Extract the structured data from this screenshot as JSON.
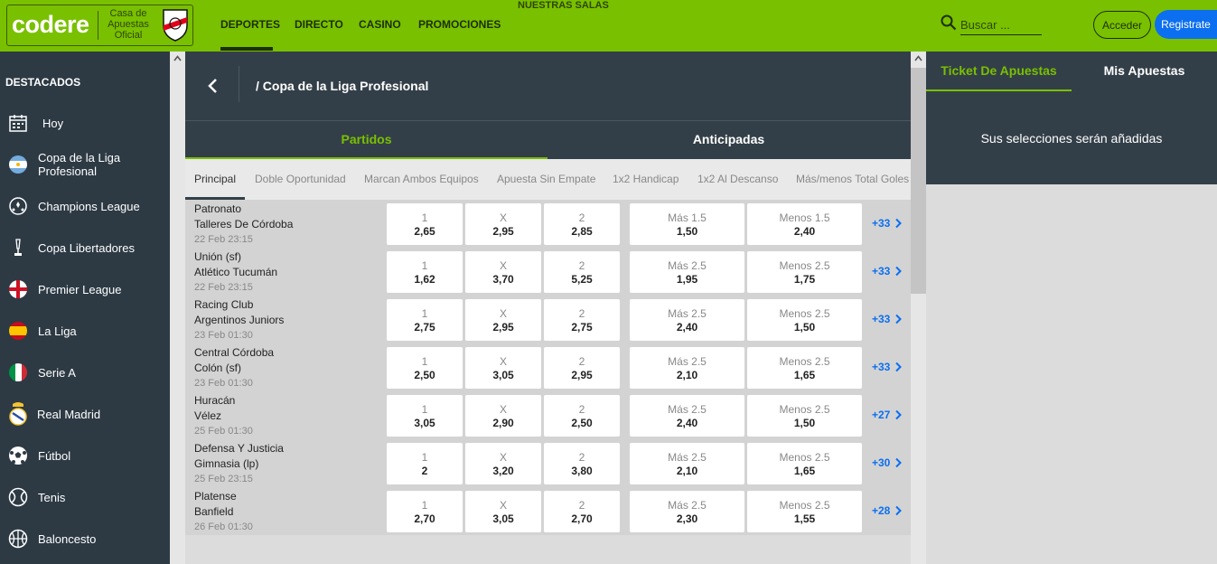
{
  "header": {
    "logo": "codere",
    "logo_tagline": "Casa de Apuestas Oficial",
    "nav": [
      "DEPORTES",
      "DIRECTO",
      "CASINO",
      "PROMOCIONES"
    ],
    "nuestras_salas": "NUESTRAS SALAS",
    "search_placeholder": "Buscar ...",
    "login_label": "Acceder",
    "register_label": "Registrate"
  },
  "sidebar": {
    "title": "DESTACADOS",
    "items": [
      {
        "label": "Hoy",
        "icon": "calendar-icon"
      },
      {
        "label": "Copa de la Liga Profesional",
        "icon": "argentina-flag-icon"
      },
      {
        "label": "Champions League",
        "icon": "football-stars-icon"
      },
      {
        "label": "Copa Libertadores",
        "icon": "trophy-icon"
      },
      {
        "label": "Premier League",
        "icon": "england-flag-icon"
      },
      {
        "label": "La Liga",
        "icon": "spain-flag-icon"
      },
      {
        "label": "Serie A",
        "icon": "italy-flag-icon"
      },
      {
        "label": "Real Madrid",
        "icon": "real-madrid-crest-icon"
      },
      {
        "label": "Fútbol",
        "icon": "football-icon"
      },
      {
        "label": "Tenis",
        "icon": "tennis-ball-icon"
      },
      {
        "label": "Baloncesto",
        "icon": "basketball-icon"
      }
    ]
  },
  "competition": {
    "title": "/ Copa de la Liga Profesional",
    "tabs": [
      "Partidos",
      "Anticipadas"
    ],
    "markets": [
      "Principal",
      "Doble Oportunidad",
      "Marcan Ambos Equipos",
      "Apuesta Sin Empate",
      "1x2 Handicap",
      "1x2 Al Descanso",
      "Más/menos Total Goles"
    ]
  },
  "events": [
    {
      "home": "Patronato",
      "away": "Talleres De Córdoba",
      "date": "22 Feb 23:15",
      "odds": [
        "2,65",
        "2,95",
        "2,85"
      ],
      "over_label": "Más 1.5",
      "over": "1,50",
      "under_label": "Menos 1.5",
      "under": "2,40",
      "more": "+33"
    },
    {
      "home": "Unión (sf)",
      "away": "Atlético Tucumán",
      "date": "22 Feb 23:15",
      "odds": [
        "1,62",
        "3,70",
        "5,25"
      ],
      "over_label": "Más 2.5",
      "over": "1,95",
      "under_label": "Menos 2.5",
      "under": "1,75",
      "more": "+33"
    },
    {
      "home": "Racing Club",
      "away": "Argentinos Juniors",
      "date": "23 Feb 01:30",
      "odds": [
        "2,75",
        "2,95",
        "2,75"
      ],
      "over_label": "Más 2.5",
      "over": "2,40",
      "under_label": "Menos 2.5",
      "under": "1,50",
      "more": "+33"
    },
    {
      "home": "Central Córdoba",
      "away": "Colón (sf)",
      "date": "23 Feb 01:30",
      "odds": [
        "2,50",
        "3,05",
        "2,95"
      ],
      "over_label": "Más 2.5",
      "over": "2,10",
      "under_label": "Menos 2.5",
      "under": "1,65",
      "more": "+33"
    },
    {
      "home": "Huracán",
      "away": "Vélez",
      "date": "25 Feb 01:30",
      "odds": [
        "3,05",
        "2,90",
        "2,50"
      ],
      "over_label": "Más 2.5",
      "over": "2,40",
      "under_label": "Menos 2.5",
      "under": "1,50",
      "more": "+27"
    },
    {
      "home": "Defensa Y Justicia",
      "away": "Gimnasia (lp)",
      "date": "25 Feb 23:15",
      "odds": [
        "2",
        "3,20",
        "3,80"
      ],
      "over_label": "Más 2.5",
      "over": "2,10",
      "under_label": "Menos 2.5",
      "under": "1,65",
      "more": "+30"
    },
    {
      "home": "Platense",
      "away": "Banfield",
      "date": "26 Feb 01:30",
      "odds": [
        "2,70",
        "3,05",
        "2,70"
      ],
      "over_label": "Más 2.5",
      "over": "2,30",
      "under_label": "Menos 2.5",
      "under": "1,55",
      "more": "+28"
    }
  ],
  "outcome_labels": [
    "1",
    "X",
    "2"
  ],
  "ticket": {
    "tabs": [
      "Ticket De Apuestas",
      "Mis Apuestas"
    ],
    "empty_message": "Sus selecciones serán añadidas"
  },
  "colors": {
    "brand_green": "#79c000",
    "dark_panel": "#333f48",
    "sidebar": "#2d3a44",
    "link_blue": "#0c6ff0"
  }
}
